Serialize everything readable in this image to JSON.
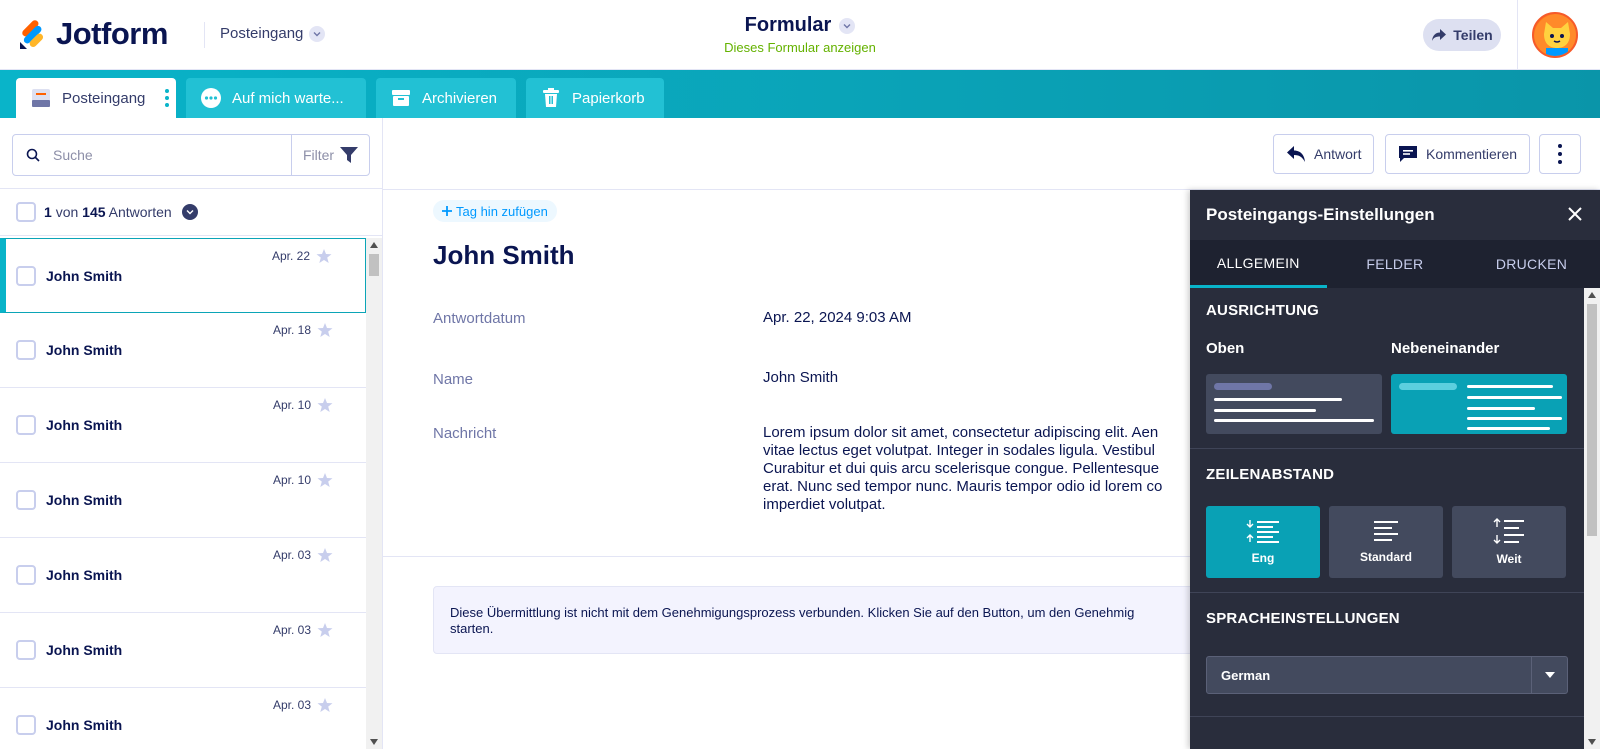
{
  "app": {
    "brand": "Jotform",
    "inbox_label": "Posteingang"
  },
  "form": {
    "title": "Formular",
    "view_link": "Dieses Formular anzeigen"
  },
  "header": {
    "share_label": "Teilen"
  },
  "tabs": [
    {
      "label": "Posteingang"
    },
    {
      "label": "Auf mich warte..."
    },
    {
      "label": "Archivieren"
    },
    {
      "label": "Papierkorb"
    }
  ],
  "search": {
    "placeholder": "Suche",
    "filter_label": "Filter"
  },
  "count": {
    "current": "1",
    "von": "von",
    "total": "145",
    "suffix": "Antworten"
  },
  "list": [
    {
      "name": "John Smith",
      "date": "Apr. 22"
    },
    {
      "name": "John Smith",
      "date": "Apr. 18"
    },
    {
      "name": "John Smith",
      "date": "Apr. 10"
    },
    {
      "name": "John Smith",
      "date": "Apr. 10"
    },
    {
      "name": "John Smith",
      "date": "Apr. 03"
    },
    {
      "name": "John Smith",
      "date": "Apr. 03"
    },
    {
      "name": "John Smith",
      "date": "Apr. 03"
    }
  ],
  "actions": {
    "reply": "Antwort",
    "comment": "Kommentieren"
  },
  "submission": {
    "add_tag": "Tag hin zufügen",
    "name": "John Smith",
    "fields": [
      {
        "label": "Antwortdatum",
        "value": "Apr. 22, 2024 9:03 AM"
      },
      {
        "label": "Name",
        "value": "John Smith"
      },
      {
        "label": "Nachricht",
        "lines": [
          "Lorem ipsum dolor sit amet, consectetur adipiscing elit. Aen",
          "vitae lectus eget volutpat. Integer in sodales ligula. Vestibul",
          "Curabitur et dui quis arcu scelerisque congue. Pellentesque",
          "erat. Nunc sed tempor nunc. Mauris tempor odio id lorem co",
          "imperdiet volutpat."
        ]
      }
    ],
    "notice_lines": [
      "Diese Übermittlung ist nicht mit dem Genehmigungsprozess verbunden. Klicken Sie auf den Button, um den Genehmig",
      "starten."
    ]
  },
  "settings": {
    "title": "Posteingangs-Einstellungen",
    "tabs": [
      "ALLGEMEIN",
      "FELDER",
      "DRUCKEN"
    ],
    "alignment_title": "AUSRICHTUNG",
    "alignment_options": [
      "Oben",
      "Nebeneinander"
    ],
    "spacing_title": "ZEILENABSTAND",
    "spacing_options": [
      "Eng",
      "Standard",
      "Weit"
    ],
    "language_title": "SPRACHEINSTELLUNGEN",
    "language_value": "German"
  },
  "colors": {
    "accent": "#09b4c9",
    "panel": "#292d3c",
    "navy": "#0a1551",
    "green": "#64b200"
  }
}
